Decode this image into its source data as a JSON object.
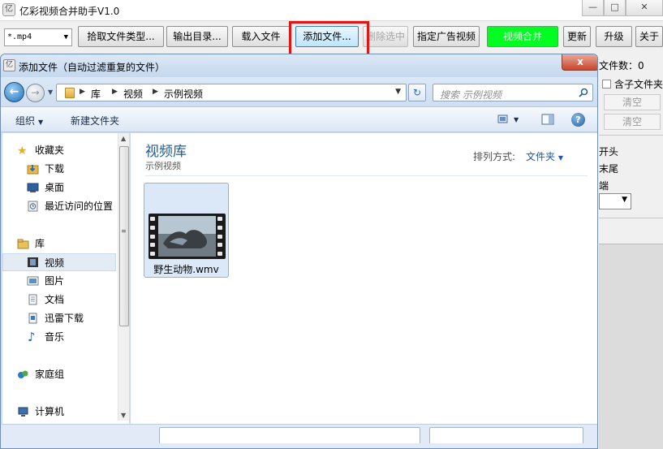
{
  "app": {
    "title": "亿彩视频合并助手V1.0",
    "icon": "app-logo-icon",
    "file_type_combo": "*.mp4",
    "buttons": {
      "pick_type": "拾取文件类型...",
      "output_dir": "输出目录...",
      "load_file": "载入文件",
      "add_file": "添加文件...",
      "delete_selected": "删除选中",
      "ad_video": "指定广告视频",
      "merge": "视频合并",
      "update": "更新",
      "upgrade": "升级",
      "about": "关于"
    },
    "right_panel": {
      "file_count_label": "文件数：0",
      "subfolder_label": "含子文件夹",
      "clear_btn_1": "清空",
      "clear_btn_2": "清空",
      "head_label": "开头",
      "tail_label": "末尾",
      "end_label": "端"
    }
  },
  "dialog": {
    "title": "添加文件（自动过滤重复的文件）",
    "close_label": "x",
    "breadcrumb": [
      "库",
      "视频",
      "示例视频"
    ],
    "search_placeholder": "搜索 示例视频",
    "toolbar": {
      "organize": "组织",
      "new_folder": "新建文件夹"
    },
    "nav_items": [
      {
        "label": "收藏夹",
        "icon": "star-icon"
      },
      {
        "label": "下载",
        "icon": "downloads-folder-icon"
      },
      {
        "label": "桌面",
        "icon": "desktop-icon"
      },
      {
        "label": "最近访问的位置",
        "icon": "recent-places-icon"
      },
      {
        "label": "库",
        "icon": "library-icon"
      },
      {
        "label": "视频",
        "icon": "video-library-icon",
        "selected": true
      },
      {
        "label": "图片",
        "icon": "pictures-icon"
      },
      {
        "label": "文档",
        "icon": "documents-icon"
      },
      {
        "label": "迅雷下载",
        "icon": "thunder-download-icon"
      },
      {
        "label": "音乐",
        "icon": "music-icon"
      },
      {
        "label": "家庭组",
        "icon": "homegroup-icon"
      },
      {
        "label": "计算机",
        "icon": "computer-icon"
      }
    ],
    "library": {
      "title": "视频库",
      "subtitle": "示例视频",
      "sort_label": "排列方式:",
      "sort_value": "文件夹"
    },
    "files": [
      {
        "name": "野生动物.wmv",
        "icon": "video-thumbnail"
      }
    ]
  },
  "colors": {
    "merge_button": "#00ff21",
    "highlight": "#e81313",
    "library_title": "#1e5b91",
    "dialog_chrome": "#cbdcf0"
  }
}
